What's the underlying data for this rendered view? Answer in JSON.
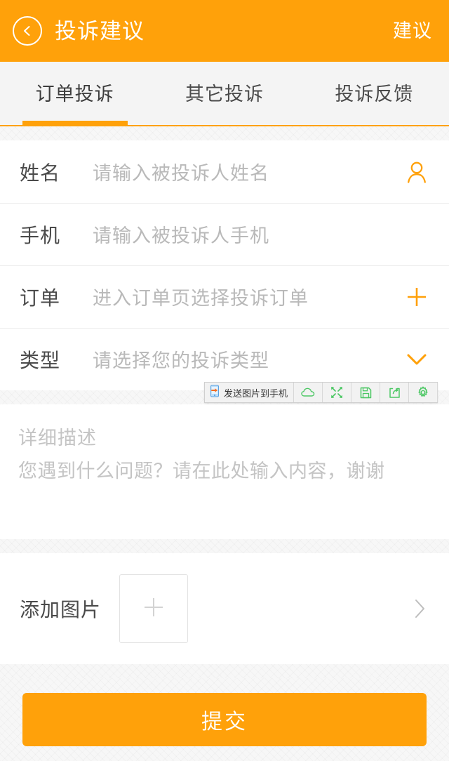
{
  "header": {
    "back_icon": "chevron-left-circle-icon",
    "title": "投诉建议",
    "action_label": "建议",
    "bg_color": "#FFA10A"
  },
  "tabs": {
    "items": [
      {
        "label": "订单投诉",
        "active": true
      },
      {
        "label": "其它投诉",
        "active": false
      },
      {
        "label": "投诉反馈",
        "active": false
      }
    ],
    "active_index": 0,
    "accent_color": "#FFA10A"
  },
  "form": {
    "fields": [
      {
        "label": "姓名",
        "value": "",
        "placeholder": "请输入被投诉人姓名",
        "icon": "user-icon",
        "icon_color": "#FFA10A"
      },
      {
        "label": "手机",
        "value": "",
        "placeholder": "请输入被投诉人手机",
        "icon": "",
        "icon_color": ""
      },
      {
        "label": "订单",
        "value": "",
        "placeholder": "进入订单页选择投诉订单",
        "icon": "plus-icon",
        "icon_color": "#FFA10A"
      },
      {
        "label": "类型",
        "value": "",
        "placeholder": "请选择您的投诉类型",
        "icon": "chevron-down-icon",
        "icon_color": "#FFA10A"
      }
    ]
  },
  "description": {
    "title": "详细描述",
    "value": "",
    "placeholder": "您遇到什么问题？请在此处输入内容，谢谢"
  },
  "add_image": {
    "label": "添加图片",
    "add_icon": "plus-icon",
    "arrow_icon": "chevron-right-icon"
  },
  "submit": {
    "label": "提交",
    "color": "#FFA10A"
  },
  "capture_toolbar": {
    "send_label": "发送图片到手机",
    "send_icon": "phone-send-icon",
    "buttons": [
      {
        "icon": "cloud-icon",
        "name": "upload-to-cloud"
      },
      {
        "icon": "expand-icon",
        "name": "fullscreen"
      },
      {
        "icon": "save-icon",
        "name": "save"
      },
      {
        "icon": "share-icon",
        "name": "share"
      },
      {
        "icon": "gear-icon",
        "name": "settings"
      }
    ],
    "icon_color": "#4CC764"
  }
}
